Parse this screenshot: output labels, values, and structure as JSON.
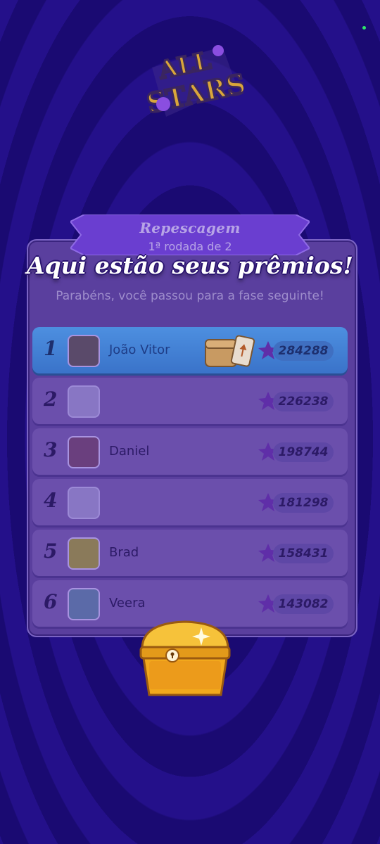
{
  "logo_text": "ALL STARS",
  "ribbon": {
    "title": "Repescagem",
    "subtitle": "1ª rodada de 2"
  },
  "headline": "Aqui estão seus prêmios!",
  "congrats": "Parabéns, você passou para a fase seguinte!",
  "leaderboard": [
    {
      "rank": "1",
      "name": "João Vitor",
      "score": "284288"
    },
    {
      "rank": "2",
      "name": "",
      "score": "226238"
    },
    {
      "rank": "3",
      "name": "Daniel",
      "score": "198744"
    },
    {
      "rank": "4",
      "name": "",
      "score": "181298"
    },
    {
      "rank": "5",
      "name": "Brad",
      "score": "158431"
    },
    {
      "rank": "6",
      "name": "Veera",
      "score": "143082"
    }
  ],
  "colors": {
    "background": "#1a0a72",
    "panel": "#5a3f9e",
    "highlight": "#4d8fe0",
    "chest": "#f2a81c"
  }
}
